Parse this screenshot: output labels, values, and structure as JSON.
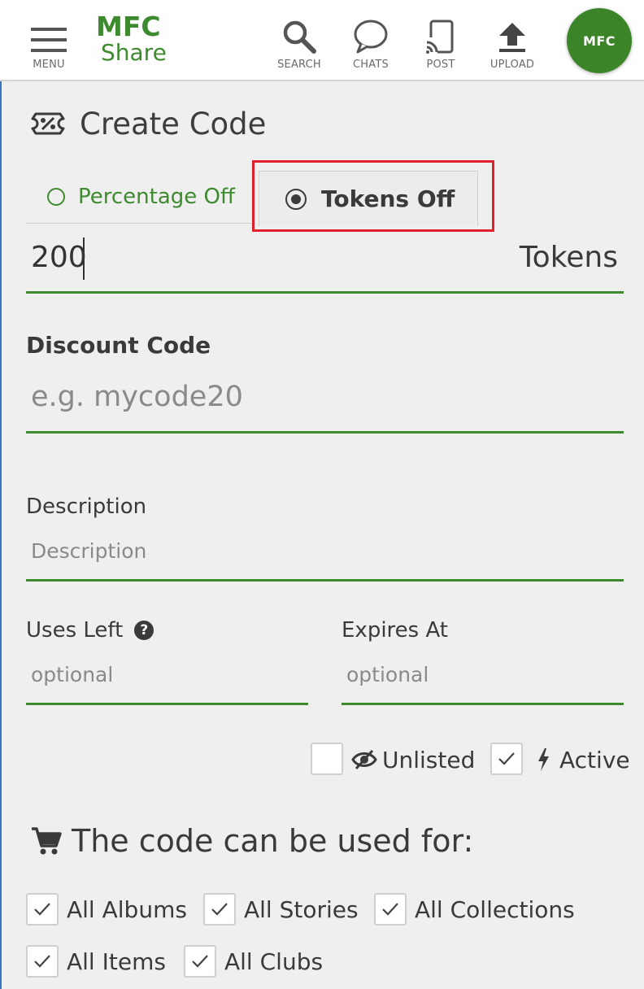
{
  "header": {
    "menu_label": "MENU",
    "logo_line1": "MFC",
    "logo_line2": "Share",
    "search_label": "SEARCH",
    "chats_label": "CHATS",
    "post_label": "POST",
    "upload_label": "UPLOAD",
    "avatar_text": "MFC",
    "brand_color": "#3d8a2f"
  },
  "page": {
    "title": "Create Code",
    "title_icon": "discount-ticket-icon"
  },
  "tabs": [
    {
      "label": "Percentage Off",
      "selected": false
    },
    {
      "label": "Tokens Off",
      "selected": true
    }
  ],
  "tokens_field": {
    "value": "200",
    "unit": "Tokens"
  },
  "discount_code": {
    "label": "Discount Code",
    "placeholder": "e.g. mycode20"
  },
  "description": {
    "label": "Description",
    "placeholder": "Description"
  },
  "uses_left": {
    "label": "Uses Left",
    "placeholder": "optional",
    "help_icon": "question-circle-icon"
  },
  "expires_at": {
    "label": "Expires At",
    "placeholder": "optional"
  },
  "flags": [
    {
      "label": "Unlisted",
      "checked": false,
      "icon": "eye-slash-icon"
    },
    {
      "label": "Active",
      "checked": true,
      "icon": "lightning-bolt-icon"
    }
  ],
  "usage": {
    "title": "The code can be used for:",
    "icon": "shopping-cart-icon",
    "options": [
      {
        "label": "All Albums",
        "checked": true
      },
      {
        "label": "All Stories",
        "checked": true
      },
      {
        "label": "All Collections",
        "checked": true
      },
      {
        "label": "All Items",
        "checked": true
      },
      {
        "label": "All Clubs",
        "checked": true
      }
    ]
  },
  "highlight_color": "#e0212d"
}
